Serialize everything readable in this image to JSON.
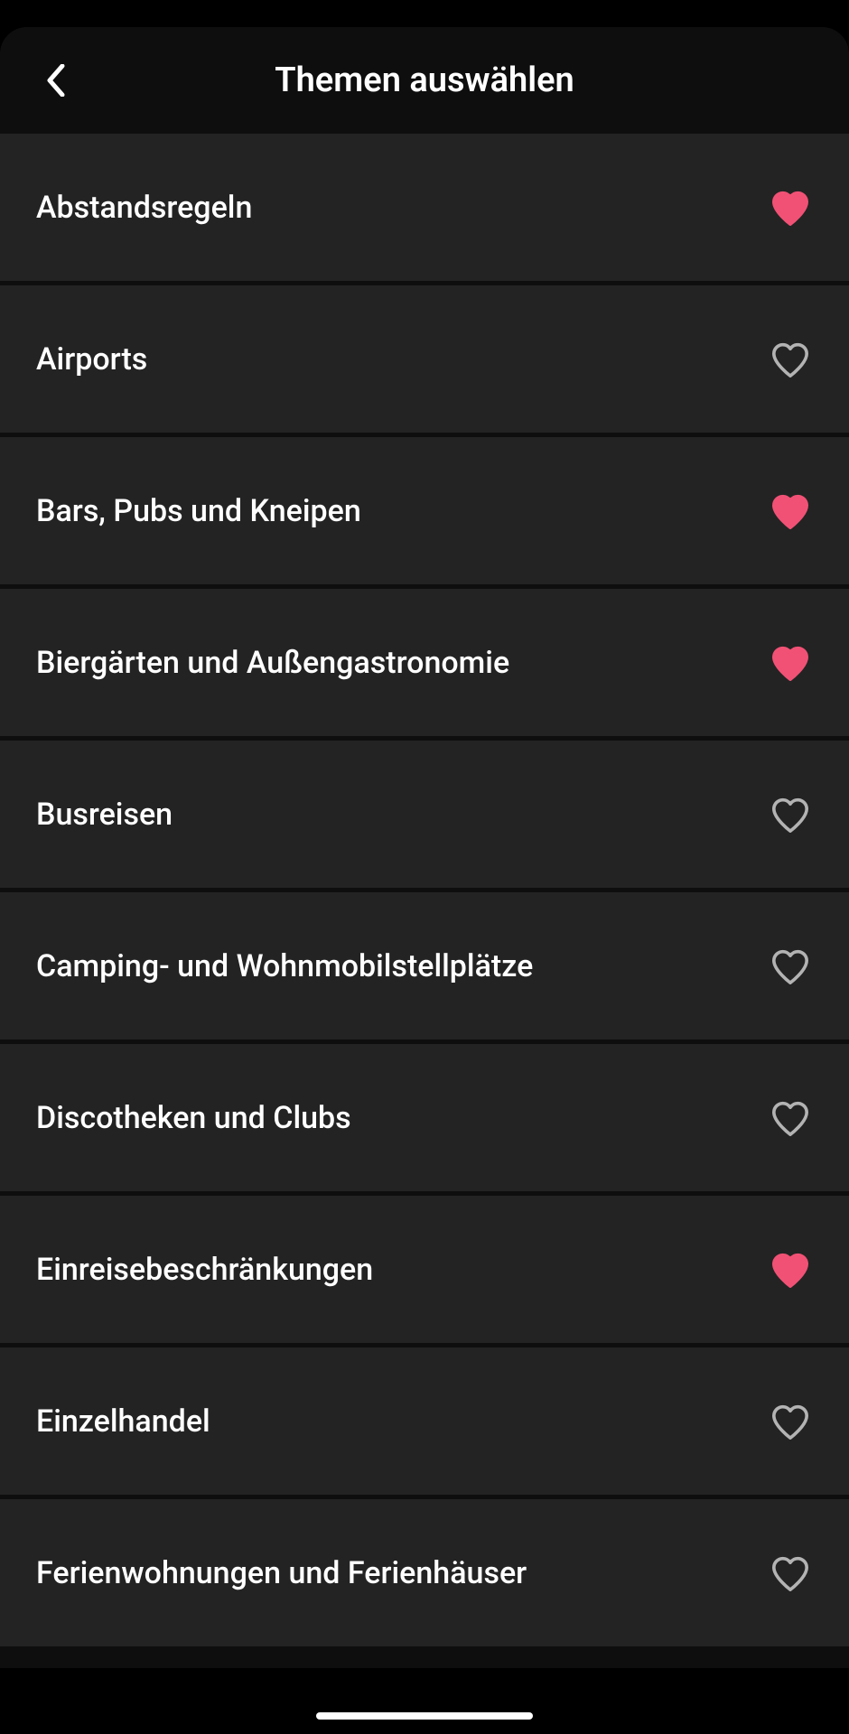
{
  "header": {
    "title": "Themen auswählen"
  },
  "topics": [
    {
      "label": "Abstandsregeln",
      "favorite": true
    },
    {
      "label": "Airports",
      "favorite": false
    },
    {
      "label": "Bars, Pubs und Kneipen",
      "favorite": true
    },
    {
      "label": "Biergärten und Außengastronomie",
      "favorite": true
    },
    {
      "label": "Busreisen",
      "favorite": false
    },
    {
      "label": "Camping- und Wohnmobilstellplätze",
      "favorite": false
    },
    {
      "label": "Discotheken und Clubs",
      "favorite": false
    },
    {
      "label": "Einreisebeschränkungen",
      "favorite": true
    },
    {
      "label": "Einzelhandel",
      "favorite": false
    },
    {
      "label": "Ferienwohnungen und Ferienhäuser",
      "favorite": false
    }
  ]
}
